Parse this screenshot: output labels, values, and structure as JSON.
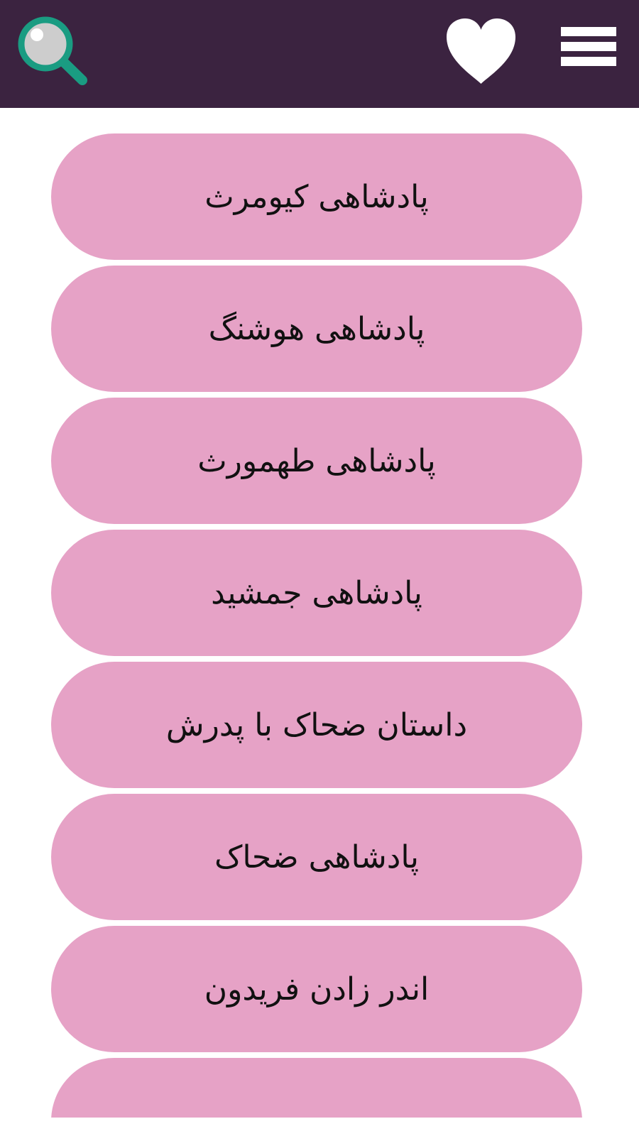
{
  "header": {
    "background": "#3b2340",
    "icons": {
      "search": "search-icon",
      "favorites": "heart-icon",
      "menu": "hamburger-menu-icon"
    }
  },
  "list": {
    "item_color": "#e6a2c6",
    "items": [
      {
        "label": "پادشاهی کیومرث"
      },
      {
        "label": "پادشاهی هوشنگ"
      },
      {
        "label": "پادشاهی طهمورث"
      },
      {
        "label": "پادشاهی جمشید"
      },
      {
        "label": "داستان ضحاک با پدرش"
      },
      {
        "label": "پادشاهی ضحاک"
      },
      {
        "label": "اندر زادن فریدون"
      },
      {
        "label": ""
      }
    ]
  }
}
